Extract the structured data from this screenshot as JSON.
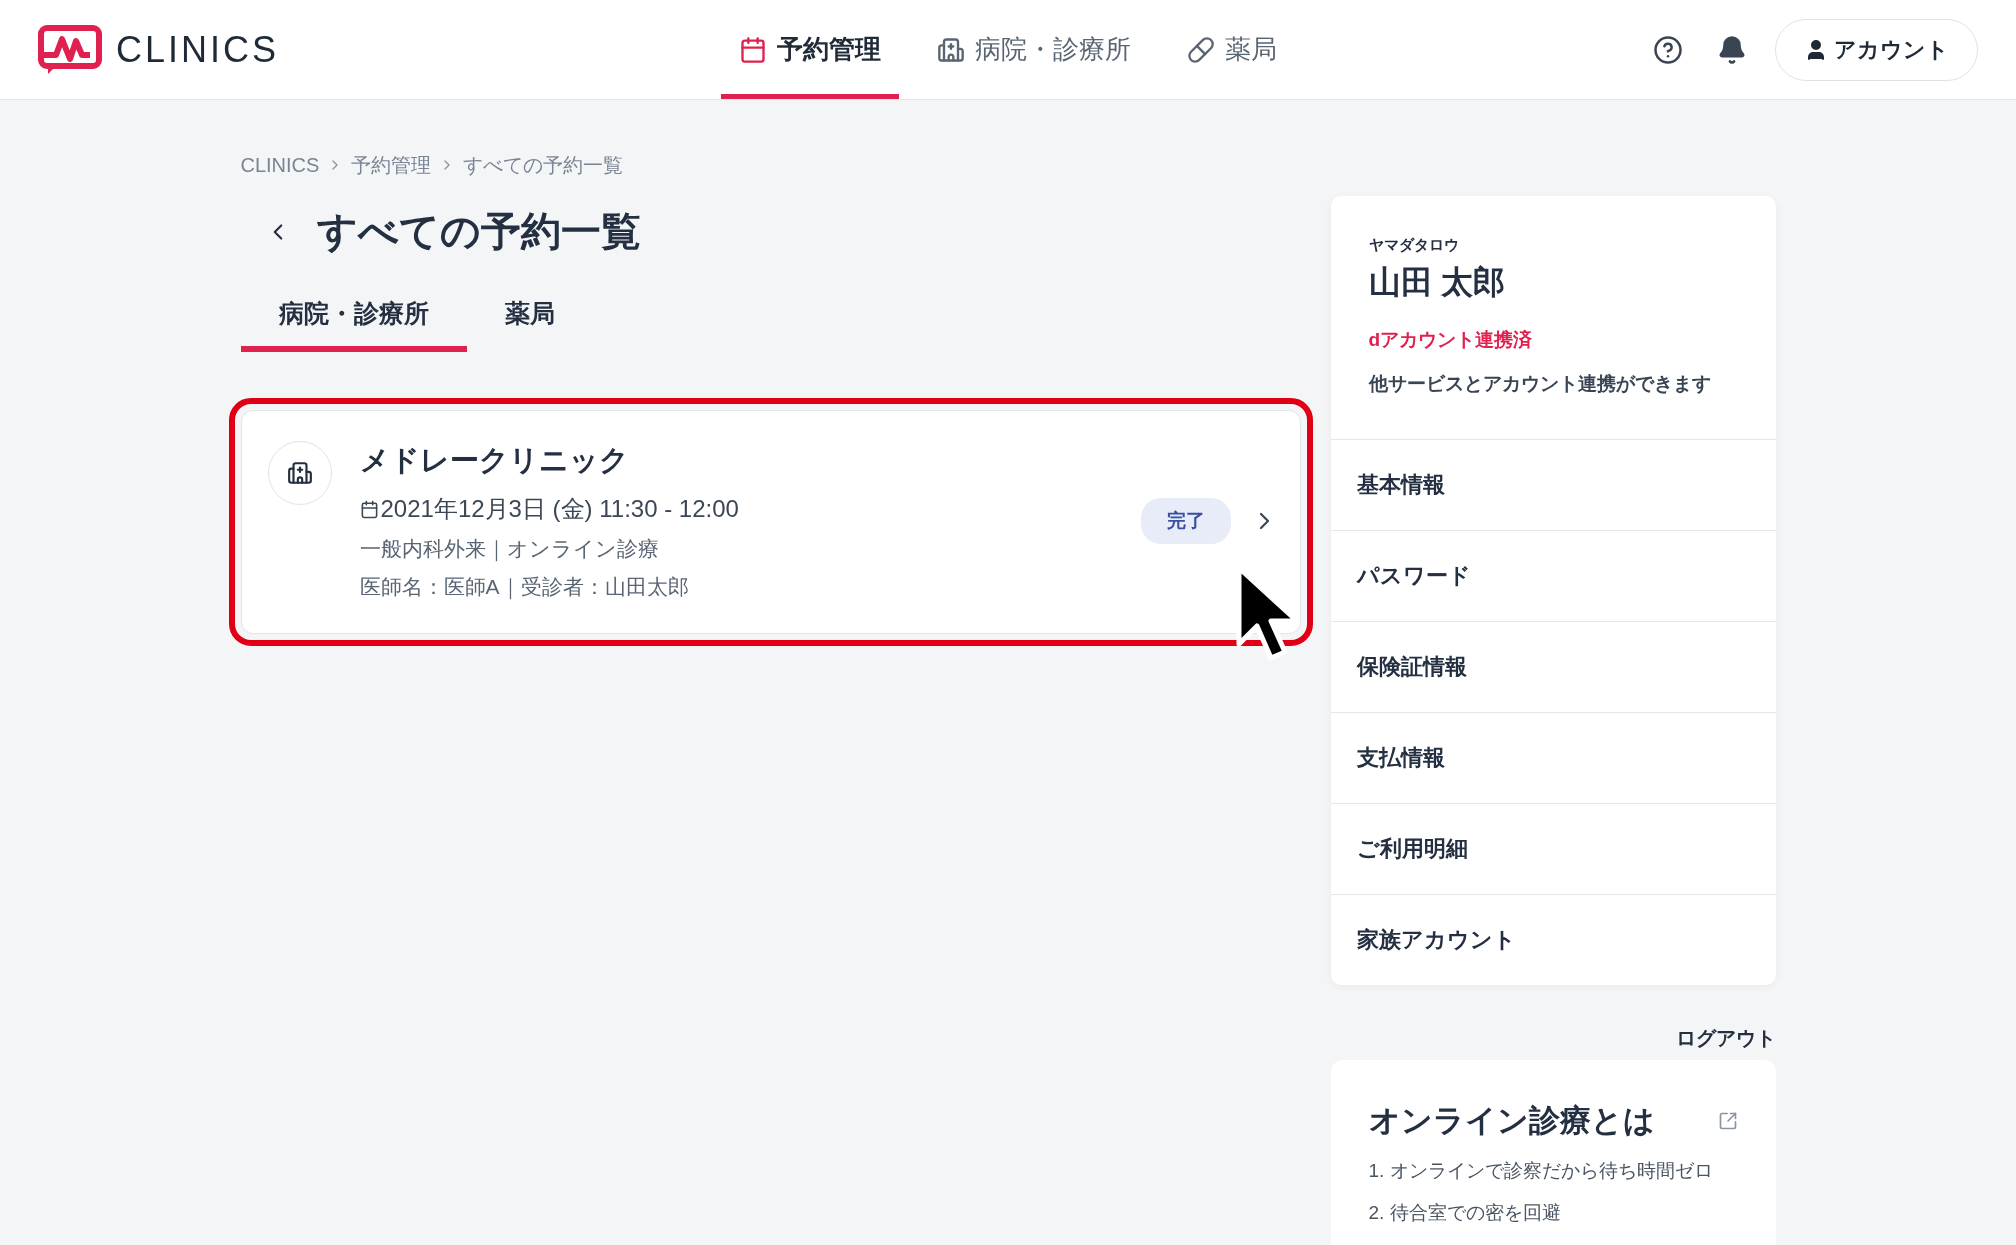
{
  "header": {
    "logo_text": "CLINICS",
    "nav": [
      {
        "label": "予約管理",
        "kind": "calendar",
        "selected": true
      },
      {
        "label": "病院・診療所",
        "kind": "hospital",
        "selected": false
      },
      {
        "label": "薬局",
        "kind": "pill",
        "selected": false
      }
    ],
    "account_button": "アカウント"
  },
  "breadcrumb": [
    "CLINICS",
    "予約管理",
    "すべての予約一覧"
  ],
  "title": "すべての予約一覧",
  "tabs": [
    {
      "label": "病院・診療所",
      "selected": true
    },
    {
      "label": "薬局",
      "selected": false
    }
  ],
  "reservations": [
    {
      "clinic": "メドレークリニック",
      "datetime": "2021年12月3日 (金) 11:30 - 12:00",
      "department": "一般内科外来｜オンライン診療",
      "doctor": "医師名：医師A｜受診者：山田太郎",
      "status": "完了",
      "highlighted": true
    }
  ],
  "profile": {
    "kana": "ヤマダタロウ",
    "name": "山田 太郎",
    "link_status": "dアカウント連携済",
    "link_note": "他サービスとアカウント連携ができます"
  },
  "menu": [
    "基本情報",
    "パスワード",
    "保険証情報",
    "支払情報",
    "ご利用明細",
    "家族アカウント"
  ],
  "logout": "ログアウト",
  "info": {
    "title": "オンライン診療とは",
    "items": [
      "1. オンラインで診察だから待ち時間ゼロ",
      "2. 待合室での密を回避"
    ]
  }
}
